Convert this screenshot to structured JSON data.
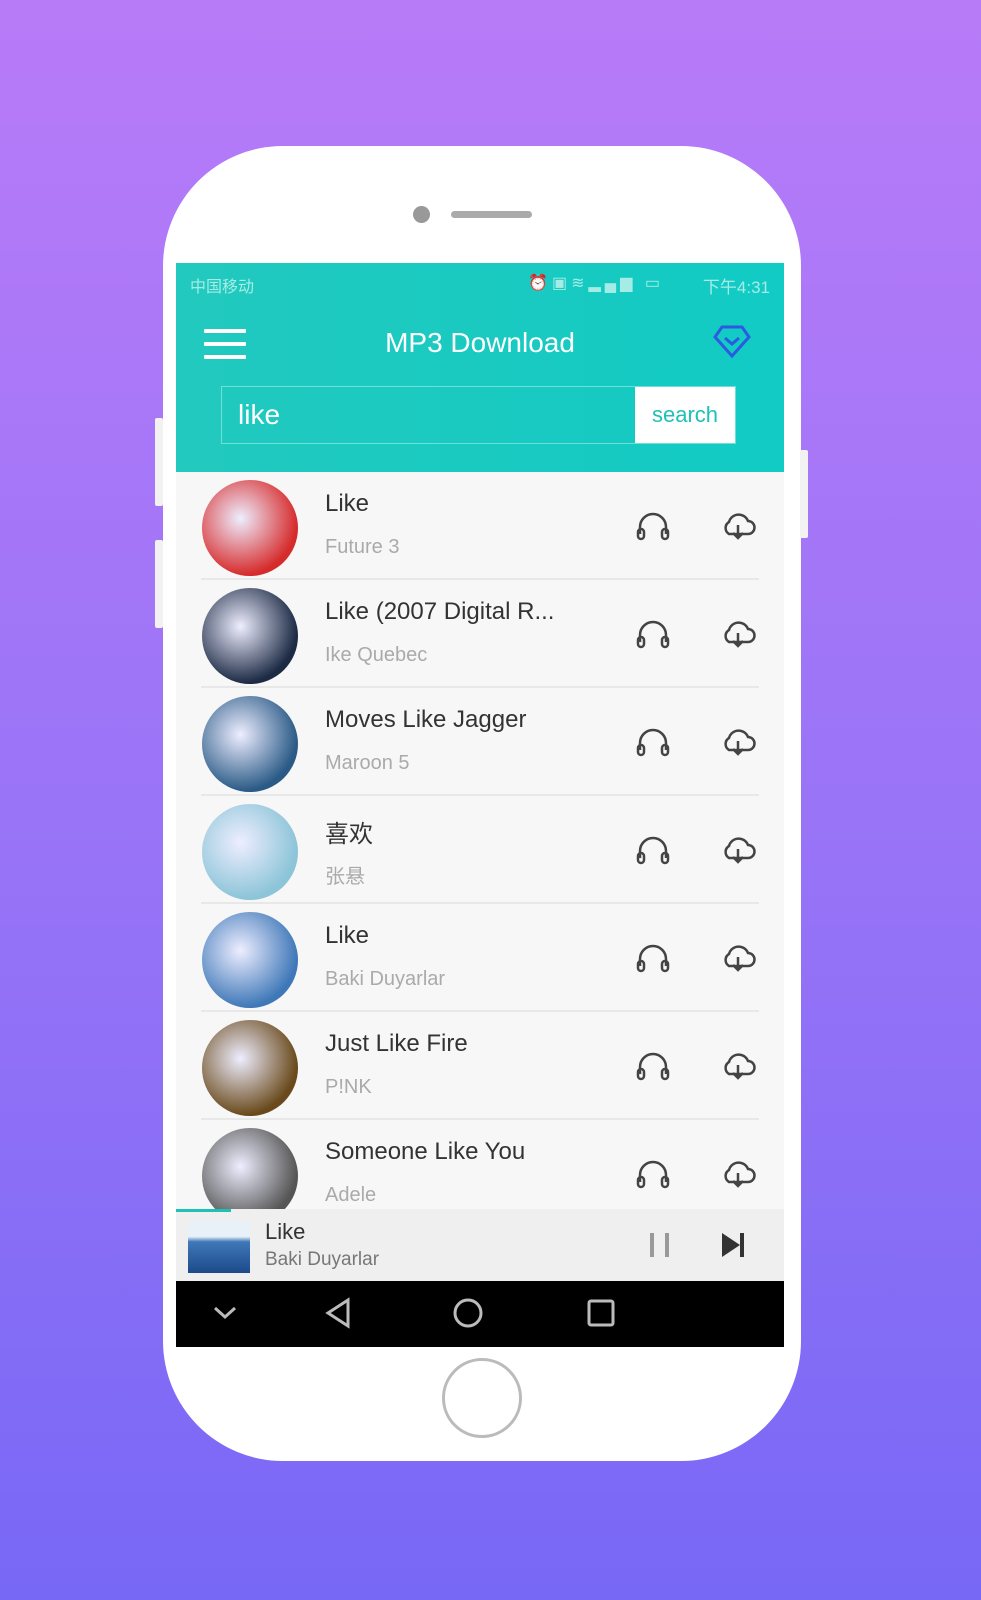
{
  "status_bar": {
    "carrier": "中国移动",
    "time": "下午4:31"
  },
  "toolbar": {
    "title": "MP3 Download",
    "menu_icon": "hamburger-icon",
    "premium_icon": "diamond-icon"
  },
  "search": {
    "value": "like",
    "button_label": "search"
  },
  "songs": [
    {
      "title": "Like",
      "artist": "Future 3",
      "art": "#d62b2b"
    },
    {
      "title": "Like (2007 Digital R...",
      "artist": "Ike Quebec",
      "art": "#1c2a44"
    },
    {
      "title": "Moves Like Jagger",
      "artist": "Maroon 5",
      "art": "#2a5a86"
    },
    {
      "title": "喜欢",
      "artist": "张悬",
      "art": "#8cc4d8"
    },
    {
      "title": "Like",
      "artist": "Baki Duyarlar",
      "art": "#3f78b8"
    },
    {
      "title": "Just Like Fire",
      "artist": "P!NK",
      "art": "#6a4a1c"
    },
    {
      "title": "Someone Like You",
      "artist": "Adele",
      "art": "#555555"
    }
  ],
  "now_playing": {
    "title": "Like",
    "artist": "Baki Duyarlar",
    "progress_percent": 9
  },
  "colors": {
    "accent": "#1fc1b6",
    "premium": "#2b5be0"
  }
}
